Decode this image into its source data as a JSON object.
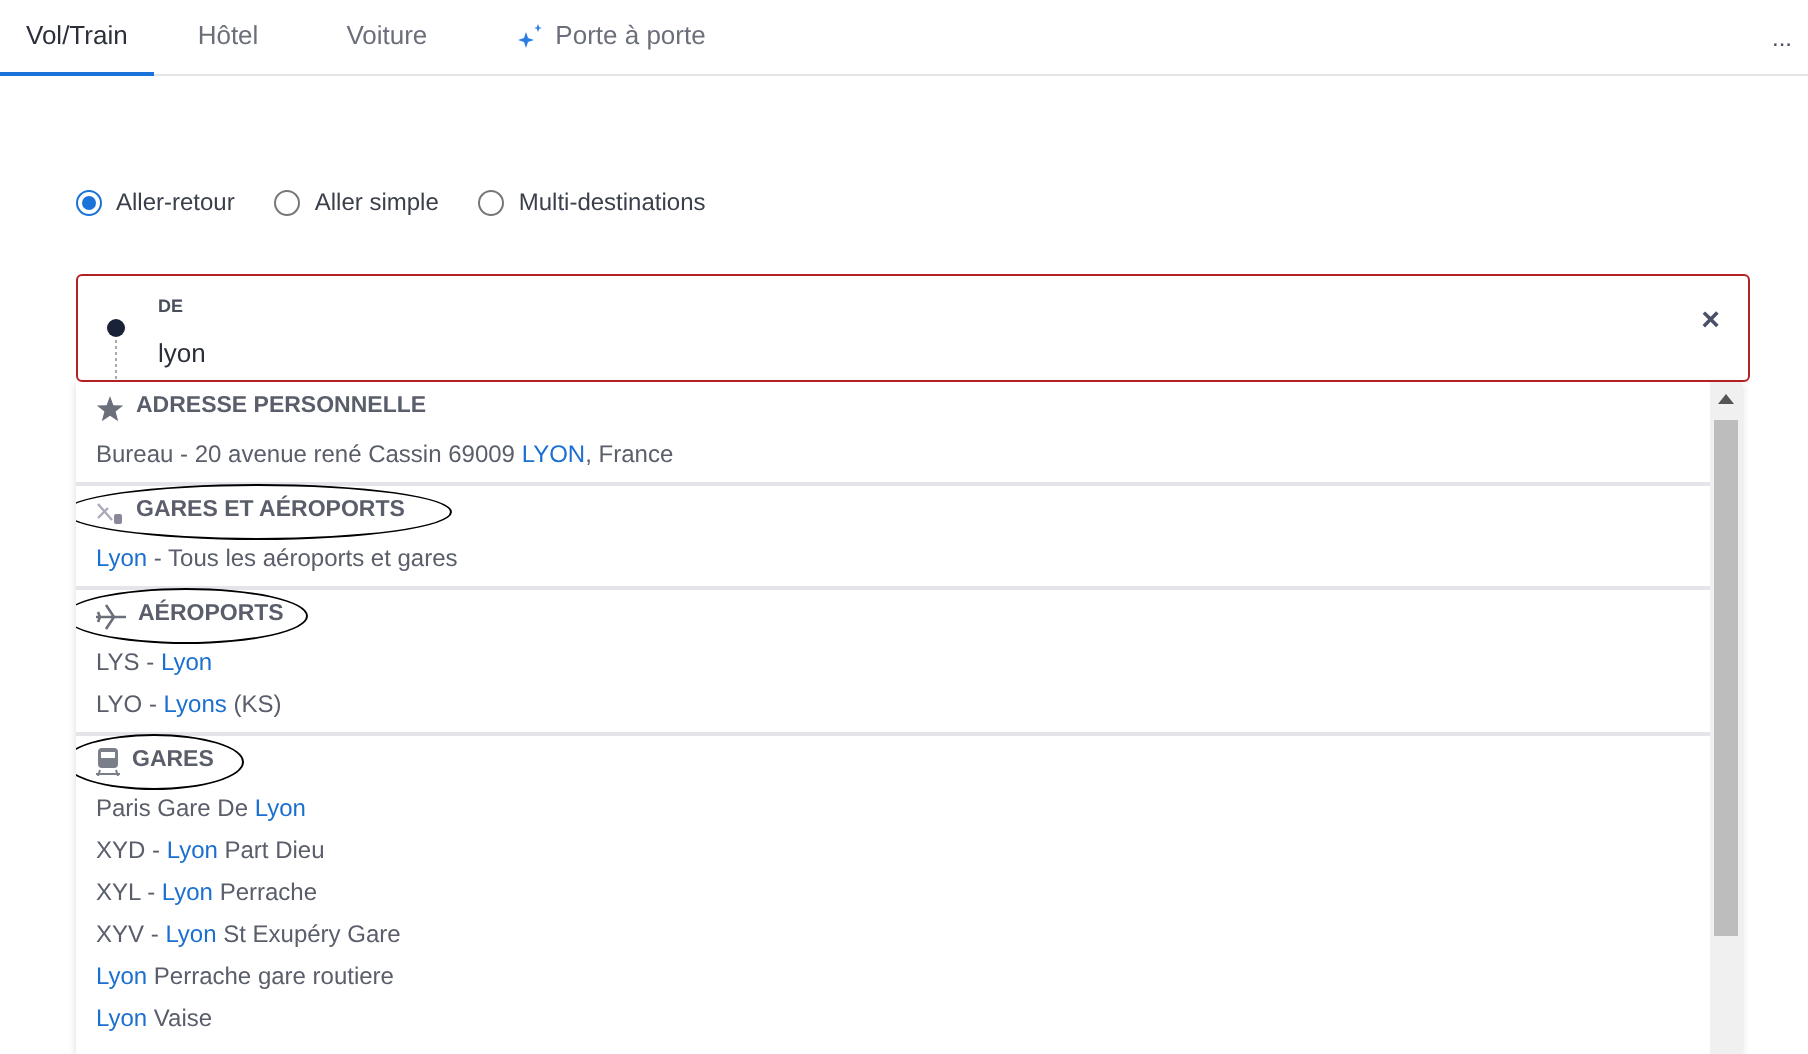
{
  "tabs": [
    {
      "label": "Vol/Train",
      "selected": true,
      "kind": "plain"
    },
    {
      "label": "Hôtel",
      "selected": false,
      "kind": "plain"
    },
    {
      "label": "Voiture",
      "selected": false,
      "kind": "plain"
    },
    {
      "label": "Porte à porte",
      "selected": false,
      "kind": "sparkle"
    }
  ],
  "more": "...",
  "trip_types": [
    {
      "label": "Aller-retour",
      "selected": true
    },
    {
      "label": "Aller simple",
      "selected": false
    },
    {
      "label": "Multi-destinations",
      "selected": false
    }
  ],
  "from_field": {
    "label": "DE",
    "value": "lyon",
    "error": true,
    "clear": "×"
  },
  "suggestions": [
    {
      "kind": "star",
      "title": "ADRESSE PERSONNELLE",
      "circled": false,
      "items": [
        {
          "parts": [
            {
              "text": "Bureau - 20 avenue rené Cassin 69009 ",
              "match": false
            },
            {
              "text": "LYON",
              "match": true
            },
            {
              "text": ", France",
              "match": false
            }
          ]
        }
      ]
    },
    {
      "kind": "all",
      "title": "GARES ET AÉROPORTS",
      "circled": true,
      "items": [
        {
          "parts": [
            {
              "text": "Lyon",
              "match": true
            },
            {
              "text": " - Tous les aéroports et gares",
              "match": false
            }
          ]
        }
      ]
    },
    {
      "kind": "plane",
      "title": "AÉROPORTS",
      "circled": true,
      "items": [
        {
          "parts": [
            {
              "text": "LYS - ",
              "match": false
            },
            {
              "text": "Lyon",
              "match": true
            }
          ]
        },
        {
          "parts": [
            {
              "text": "LYO - ",
              "match": false
            },
            {
              "text": "Lyons",
              "match": true
            },
            {
              "text": " (KS)",
              "match": false
            }
          ]
        }
      ]
    },
    {
      "kind": "train",
      "title": "GARES",
      "circled": true,
      "items": [
        {
          "parts": [
            {
              "text": "Paris Gare De ",
              "match": false
            },
            {
              "text": "Lyon",
              "match": true
            }
          ]
        },
        {
          "parts": [
            {
              "text": "XYD - ",
              "match": false
            },
            {
              "text": "Lyon",
              "match": true
            },
            {
              "text": " Part Dieu",
              "match": false
            }
          ]
        },
        {
          "parts": [
            {
              "text": "XYL - ",
              "match": false
            },
            {
              "text": "Lyon",
              "match": true
            },
            {
              "text": " Perrache",
              "match": false
            }
          ]
        },
        {
          "parts": [
            {
              "text": "XYV - ",
              "match": false
            },
            {
              "text": "Lyon",
              "match": true
            },
            {
              "text": " St Exupéry Gare",
              "match": false
            }
          ]
        },
        {
          "parts": [
            {
              "text": "Lyon",
              "match": true
            },
            {
              "text": " Perrache gare routiere",
              "match": false
            }
          ]
        },
        {
          "parts": [
            {
              "text": "Lyon",
              "match": true
            },
            {
              "text": " Vaise",
              "match": false
            }
          ]
        }
      ]
    }
  ]
}
